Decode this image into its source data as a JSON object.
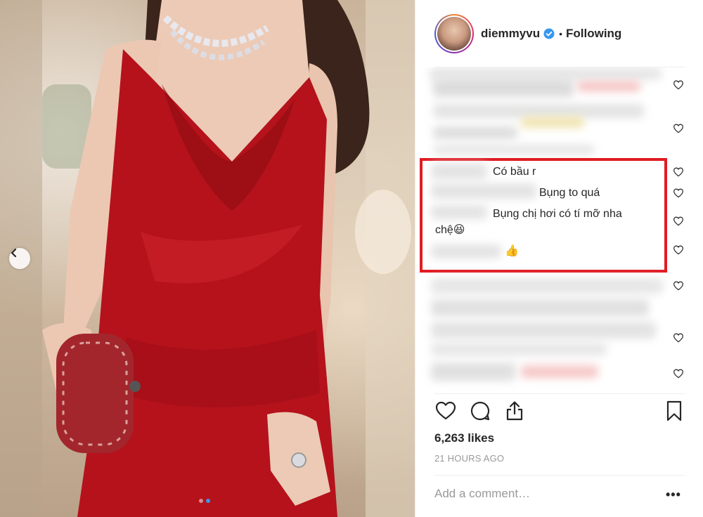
{
  "post": {
    "username": "diemmyvu",
    "follow_status": "Following",
    "separator": "•",
    "likes": "6,263 likes",
    "timestamp": "21 HOURS AGO",
    "add_comment_placeholder": "Add a comment…",
    "more_options": "•••"
  },
  "comments": [
    {
      "text": "Có bầu r"
    },
    {
      "text": "Bụng to quá"
    },
    {
      "text": "Bụng chị hơi có tí mỡ nha"
    },
    {
      "text": "chệ😆"
    },
    {
      "text": "👍"
    }
  ],
  "carousel": {
    "total": 2,
    "active_index": 1
  },
  "colors": {
    "dress": "#b5121b",
    "highlight": "#e01b23",
    "verified": "#3897f0",
    "muted": "#999999"
  },
  "icons": [
    "chevron-left-icon",
    "verified-badge-icon",
    "heart-icon",
    "comment-icon",
    "share-icon",
    "bookmark-icon"
  ]
}
